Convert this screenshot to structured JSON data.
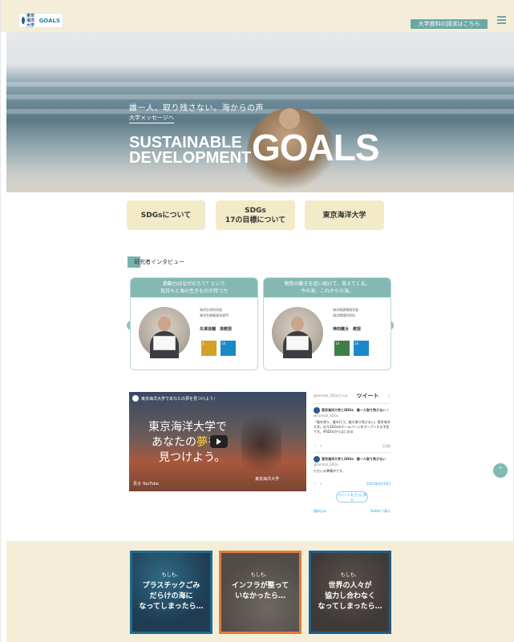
{
  "header": {
    "logo_text": "東京海洋大学",
    "logo_goals": "GOALS",
    "request_button": "大学資料の請求はこちら"
  },
  "hero": {
    "lead": "誰一人、取り残さない。海からの声",
    "link": "大学メッセージへ",
    "title_line1": "SUSTAINABLE",
    "title_line2": "DEVELOPMENT",
    "goals": "GOALS"
  },
  "nav": [
    {
      "label": "SDGsについて"
    },
    {
      "label": "SDGs\n17の目標について"
    },
    {
      "label": "東京海洋大学"
    }
  ],
  "interview": {
    "section_title": "研究者インタビュー",
    "cards": [
      {
        "headline": "筋動力はなぜだろう？という\n気持ちと海の生きものが持つ力",
        "dept": "海洋生命科学部\n海洋生物資源学部門",
        "name": "矢澤良輔　准教授",
        "sdgs": [
          {
            "num": "2",
            "color": "#d3a029"
          },
          {
            "num": "14",
            "color": "#1a88c9"
          }
        ]
      },
      {
        "headline": "物質の動きを追い続けて、見えてくる。\n今の海、これからの海。",
        "dept": "海洋資源環境学部\n海洋環境科学科",
        "name": "神田穣太　教授",
        "sdgs": [
          {
            "num": "13",
            "color": "#3f7e44"
          },
          {
            "num": "14",
            "color": "#1a88c9"
          }
        ]
      }
    ]
  },
  "video": {
    "channel_title": "東京海洋大学であなたの夢を見つけよう！",
    "line1": "東京海洋大学で",
    "line2_before": "あなたの",
    "line2_highlight": "夢",
    "line2_after": "を",
    "line3": "見つけよう。",
    "watch_label": "見る YouTube",
    "brand": "東京海洋大学"
  },
  "twitter": {
    "handle": "@tumsat_SDGsさんの",
    "title": "ツイート",
    "post1_name": "東京海洋大学とSDGs　誰一人取り残さない",
    "post1_handle": "@tumsat_SDGs",
    "post1_text": "「誰を知り、誰を行う。誰も取り残さない」東京海洋大学。近々SDGsのホームページをオープンする予定です。#SDGsからはじめる",
    "post1_date": "1月前",
    "post2_name": "東京海洋大学とSDGs　誰一人取り残さない",
    "post2_handle": "@tumsat_SDGs",
    "post2_text": "ただいま準備中です。",
    "post2_date": "2021年4月19日",
    "more": "ツイートをさらに表示",
    "embed": "埋め込み",
    "view_on": "Twitterで表示"
  },
  "tiles": [
    {
      "small": "もしも、",
      "big": "プラスチックごみ\nだらけの海に\nなってしまったら…",
      "bg": "#1f3c52",
      "border": "#1f6d8e"
    },
    {
      "small": "もしも、",
      "big": "インフラが整って\nいなかったら…",
      "bg": "#514c48",
      "border": "#e07b39"
    },
    {
      "small": "もしも、",
      "big": "世界の人々が\n協力し合わなく\nなってしまったら…",
      "bg": "#3e3a38",
      "border": "#1f5f88"
    }
  ]
}
